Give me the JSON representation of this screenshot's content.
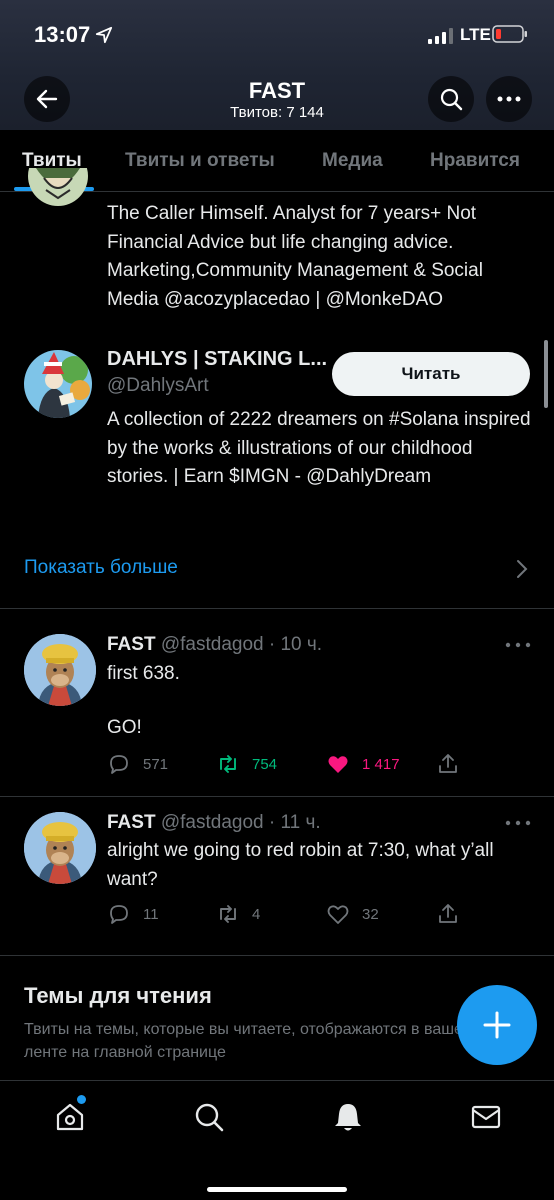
{
  "status_bar": {
    "time": "13:07",
    "network": "LTE"
  },
  "header": {
    "name": "FAST",
    "tweet_count": "Твитов: 7 144"
  },
  "tabs": [
    {
      "label": "Твиты",
      "active": true
    },
    {
      "label": "Твиты и ответы",
      "active": false
    },
    {
      "label": "Медиа",
      "active": false
    },
    {
      "label": "Нравится",
      "active": false
    }
  ],
  "recommendations": {
    "first_bio": "The Caller Himself. Analyst for 7 years+ Not Financial Advice but life changing advice. Marketing,Community Management & Social Media @acozyplacedao | @MonkeDAO",
    "second": {
      "name": "DAHLYS | STAKING L...",
      "handle": "@DahlysArt",
      "follow_label": "Читать",
      "bio": "A collection of 2222 dreamers on #Solana inspired by the works & illustrations of our childhood stories. | Earn $IMGN - @DahlyDream"
    },
    "show_more": "Показать больше"
  },
  "tweets": [
    {
      "name": "FAST",
      "meta": "@fastdagod · 10 ч.",
      "text_line1": "first 638.",
      "text_line2": "GO!",
      "replies": "571",
      "retweets": "754",
      "likes": "1 417",
      "liked": true
    },
    {
      "name": "FAST",
      "meta": "@fastdagod · 11 ч.",
      "text": "alright we going to red robin at 7:30, what y’all want?",
      "replies": "11",
      "retweets": "4",
      "likes": "32",
      "liked": false
    }
  ],
  "topics": {
    "title": "Темы для чтения",
    "subtitle": "Твиты на темы, которые вы читаете, отображаются в вашей ленте на главной странице"
  },
  "colors": {
    "accent": "#1d9bf0",
    "retweet": "#00ba7c",
    "like": "#f91880",
    "muted": "#71767b"
  },
  "icons": [
    "back-arrow-icon",
    "search-icon",
    "more-icon",
    "reply-icon",
    "retweet-icon",
    "like-icon",
    "share-icon",
    "home-icon",
    "explore-icon",
    "notifications-icon",
    "messages-icon",
    "compose-icon"
  ]
}
